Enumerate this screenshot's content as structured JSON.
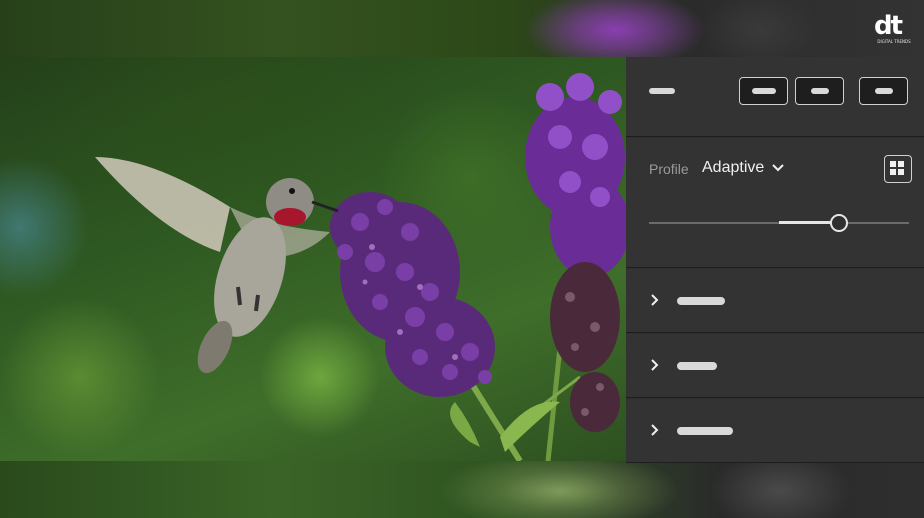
{
  "profile": {
    "label": "Profile",
    "value": "Adaptive",
    "slider_level": 0.73
  },
  "logo": {
    "mark": "dt",
    "tagline": "DIGITAL TRENDS"
  },
  "icons": {
    "profile_dropdown": "chevron-down-icon",
    "profile_browser": "grid-icon",
    "accordion": "chevron-right-icon"
  },
  "colors": {
    "panel_bg": "#333333",
    "divider": "#1e1e1e",
    "text_primary": "#f0f0f0",
    "text_secondary": "#9a9a9a"
  }
}
